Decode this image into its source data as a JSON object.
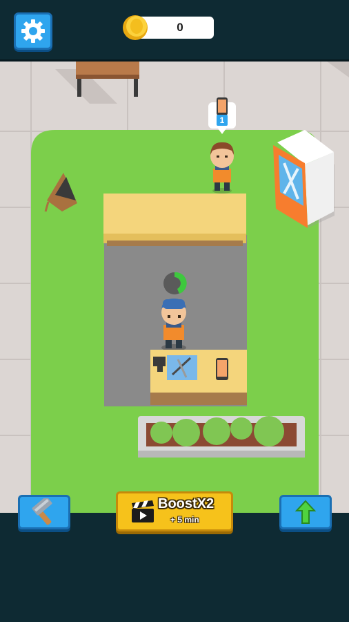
{
  "hud": {
    "coins": "0"
  },
  "buttons": {
    "boost_title": "BoostX2",
    "boost_subtitle": "+ 5 min"
  },
  "order_bubble": {
    "count": "1"
  },
  "colors": {
    "hud_bg": "#0e2a33",
    "button_blue": "#2fa5ee",
    "boost_yellow": "#f6c21b",
    "grass": "#7ccf4b",
    "floor_tile": "#dcd6d3"
  }
}
